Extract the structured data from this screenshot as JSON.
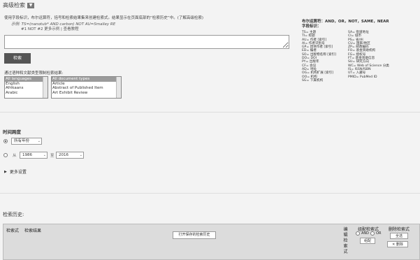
{
  "header": {
    "title": "高级检索",
    "toggle_icon": "chevron-down-icon"
  },
  "instructions": {
    "text": "使用字段标识，布尔运算符，括号和检索结果集来创建检索式。结果显示在页面底部的“检索历史”中。(了解高级检索)",
    "example_label": "示例",
    "example_line1": "TS=(nanotub* AND carbon) NOT AU=Smalley RE",
    "example_line2": "#1 NOT #2   更多示例 | 查看教程"
  },
  "query": {
    "value": ""
  },
  "search_button": {
    "label": "检索"
  },
  "operators": {
    "bool_line": "布尔运算符：AND，OR，NOT，SAME，NEAR",
    "fields_line": "字段标识：",
    "left": [
      "TS= 主题",
      "TI= 标题",
      "AU= 作者 [索引]",
      "AI= 作者识别号",
      "GP= 团体作者 [索引]",
      "ED= 编者",
      "SO= 出版物名称 [索引]",
      "DO= DOI",
      "PY= 出版年",
      "CF= 会议",
      "AD= 地址",
      "OG= 机构扩展 [索引]",
      "OO= 机构",
      "SG= 下属机构"
    ],
    "right": [
      "SA= 街道地址",
      "CI= 城市",
      "PS= 省/州",
      "CU= 国家/地区",
      "ZP= 邮政编码",
      "FO= 基金资助机构",
      "FG= 授权号",
      "FT= 基金资助信息",
      "SU= 研究方向",
      "WC= Web of Science 分类",
      "IS= ISSN/ISBN",
      "UT= 入藏号",
      "PMID= PubMed ID"
    ]
  },
  "limits": {
    "label": "通过语种和文献类型限制检索结果:",
    "languages": [
      "All languages",
      "English",
      "Afrikaans",
      "Arabic"
    ],
    "doc_types": [
      "All document types",
      "Article",
      "Abstract of Published Item",
      "Art Exhibit Review"
    ]
  },
  "timespan": {
    "title": "时间跨度",
    "option_all": "所有年份",
    "from_label": "从",
    "from_year": "1986",
    "to_label": "至",
    "to_year": "2016"
  },
  "more_settings": {
    "label": "更多设置"
  },
  "history": {
    "title": "检索历史:",
    "col_query": "检索式",
    "col_results": "检索结果",
    "open_saved_button": "打开保存的检索历史",
    "col_edit": "编辑检索式",
    "combine_title": "组配检索式",
    "and_label": "AND",
    "or_label": "OR",
    "combine_button": "组配",
    "delete_title": "删除检索式",
    "select_all_button": "全选",
    "delete_button": "✕ 删除"
  }
}
